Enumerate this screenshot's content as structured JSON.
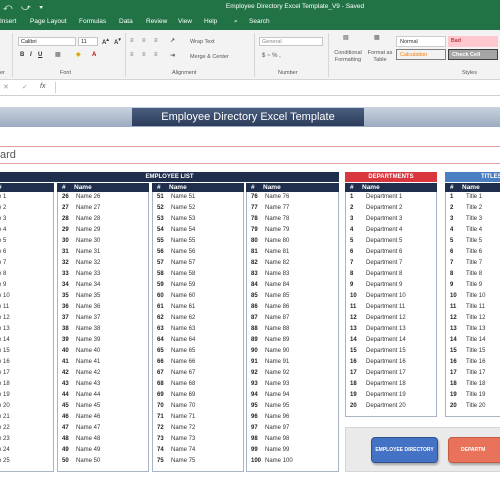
{
  "window": {
    "title": "Employee Directory Excel Template_V9  -  Saved",
    "quick_access": "⤺ ⤻ ▾"
  },
  "ribbon": {
    "tabs": [
      "Insert",
      "Page Layout",
      "Formulas",
      "Data",
      "Review",
      "View",
      "Help"
    ],
    "tell_me": "Search",
    "font_name": "Calibri",
    "font_size": "11",
    "number_format": "General",
    "wrap_text": "Wrap Text",
    "merge_center": "Merge & Center",
    "conditional_formatting": "Conditional Formatting",
    "format_as_table": "Format as Table",
    "styles": {
      "normal": "Normal",
      "bad": "Bad",
      "calculation": "Calculation",
      "check_cell": "Check Cell"
    },
    "groups": {
      "clipboard_tail": "er",
      "font": "Font",
      "alignment": "Alignment",
      "number": "Number",
      "styles": "Styles"
    },
    "currency_sign": "$ ~ % ,"
  },
  "sheet": {
    "banner_title": "Employee Directory Excel Template",
    "dashboard_label": "ard",
    "employee_list_header": "EMPLOYEE LIST",
    "departments_header": "DEPARTMENTS",
    "titles_header": "TITLES",
    "col_num": "#",
    "col_name": "Name",
    "employees_col0": [
      {
        "n": "",
        "name": "e 1"
      },
      {
        "n": "",
        "name": "e 2"
      },
      {
        "n": "",
        "name": "e 3"
      },
      {
        "n": "",
        "name": "e 4"
      },
      {
        "n": "",
        "name": "e 5"
      },
      {
        "n": "",
        "name": "e 6"
      },
      {
        "n": "",
        "name": "e 7"
      },
      {
        "n": "",
        "name": "e 8"
      },
      {
        "n": "",
        "name": "e 9"
      },
      {
        "n": "",
        "name": "e 10"
      },
      {
        "n": "",
        "name": "e 11"
      },
      {
        "n": "",
        "name": "e 12"
      },
      {
        "n": "",
        "name": "e 13"
      },
      {
        "n": "",
        "name": "e 14"
      },
      {
        "n": "",
        "name": "e 15"
      },
      {
        "n": "",
        "name": "e 16"
      },
      {
        "n": "",
        "name": "e 17"
      },
      {
        "n": "",
        "name": "e 18"
      },
      {
        "n": "",
        "name": "e 19"
      },
      {
        "n": "",
        "name": "e 20"
      },
      {
        "n": "",
        "name": "e 21"
      },
      {
        "n": "",
        "name": "e 22"
      },
      {
        "n": "",
        "name": "e 23"
      },
      {
        "n": "",
        "name": "e 24"
      },
      {
        "n": "",
        "name": "e 25"
      }
    ],
    "employees_col1": [
      {
        "n": "26",
        "name": "Name 26"
      },
      {
        "n": "27",
        "name": "Name 27"
      },
      {
        "n": "28",
        "name": "Name 28"
      },
      {
        "n": "29",
        "name": "Name 29"
      },
      {
        "n": "30",
        "name": "Name 30"
      },
      {
        "n": "31",
        "name": "Name 31"
      },
      {
        "n": "32",
        "name": "Name 32"
      },
      {
        "n": "33",
        "name": "Name 33"
      },
      {
        "n": "34",
        "name": "Name 34"
      },
      {
        "n": "35",
        "name": "Name 35"
      },
      {
        "n": "36",
        "name": "Name 36"
      },
      {
        "n": "37",
        "name": "Name 37"
      },
      {
        "n": "38",
        "name": "Name 38"
      },
      {
        "n": "39",
        "name": "Name 39"
      },
      {
        "n": "40",
        "name": "Name 40"
      },
      {
        "n": "41",
        "name": "Name 41"
      },
      {
        "n": "42",
        "name": "Name 42"
      },
      {
        "n": "43",
        "name": "Name 43"
      },
      {
        "n": "44",
        "name": "Name 44"
      },
      {
        "n": "45",
        "name": "Name 45"
      },
      {
        "n": "46",
        "name": "Name 46"
      },
      {
        "n": "47",
        "name": "Name 47"
      },
      {
        "n": "48",
        "name": "Name 48"
      },
      {
        "n": "49",
        "name": "Name 49"
      },
      {
        "n": "50",
        "name": "Name 50"
      }
    ],
    "employees_col2": [
      {
        "n": "51",
        "name": "Name 51"
      },
      {
        "n": "52",
        "name": "Name 52"
      },
      {
        "n": "53",
        "name": "Name 53"
      },
      {
        "n": "54",
        "name": "Name 54"
      },
      {
        "n": "55",
        "name": "Name 55"
      },
      {
        "n": "56",
        "name": "Name 56"
      },
      {
        "n": "57",
        "name": "Name 57"
      },
      {
        "n": "58",
        "name": "Name 58"
      },
      {
        "n": "59",
        "name": "Name 59"
      },
      {
        "n": "60",
        "name": "Name 60"
      },
      {
        "n": "61",
        "name": "Name 61"
      },
      {
        "n": "62",
        "name": "Name 62"
      },
      {
        "n": "63",
        "name": "Name 63"
      },
      {
        "n": "64",
        "name": "Name 64"
      },
      {
        "n": "65",
        "name": "Name 65"
      },
      {
        "n": "66",
        "name": "Name 66"
      },
      {
        "n": "67",
        "name": "Name 67"
      },
      {
        "n": "68",
        "name": "Name 68"
      },
      {
        "n": "69",
        "name": "Name 69"
      },
      {
        "n": "70",
        "name": "Name 70"
      },
      {
        "n": "71",
        "name": "Name 71"
      },
      {
        "n": "72",
        "name": "Name 72"
      },
      {
        "n": "73",
        "name": "Name 73"
      },
      {
        "n": "74",
        "name": "Name 74"
      },
      {
        "n": "75",
        "name": "Name 75"
      }
    ],
    "employees_col3": [
      {
        "n": "76",
        "name": "Name 76"
      },
      {
        "n": "77",
        "name": "Name 77"
      },
      {
        "n": "78",
        "name": "Name 78"
      },
      {
        "n": "79",
        "name": "Name 79"
      },
      {
        "n": "80",
        "name": "Name 80"
      },
      {
        "n": "81",
        "name": "Name 81"
      },
      {
        "n": "82",
        "name": "Name 82"
      },
      {
        "n": "83",
        "name": "Name 83"
      },
      {
        "n": "84",
        "name": "Name 84"
      },
      {
        "n": "85",
        "name": "Name 85"
      },
      {
        "n": "86",
        "name": "Name 86"
      },
      {
        "n": "87",
        "name": "Name 87"
      },
      {
        "n": "88",
        "name": "Name 88"
      },
      {
        "n": "89",
        "name": "Name 89"
      },
      {
        "n": "90",
        "name": "Name 90"
      },
      {
        "n": "91",
        "name": "Name 91"
      },
      {
        "n": "92",
        "name": "Name 92"
      },
      {
        "n": "93",
        "name": "Name 93"
      },
      {
        "n": "94",
        "name": "Name 94"
      },
      {
        "n": "95",
        "name": "Name 95"
      },
      {
        "n": "96",
        "name": "Name 96"
      },
      {
        "n": "97",
        "name": "Name 97"
      },
      {
        "n": "98",
        "name": "Name 98"
      },
      {
        "n": "99",
        "name": "Name 99"
      },
      {
        "n": "100",
        "name": "Name 100"
      }
    ],
    "departments": [
      {
        "n": "1",
        "name": "Department 1"
      },
      {
        "n": "2",
        "name": "Department 2"
      },
      {
        "n": "3",
        "name": "Department 3"
      },
      {
        "n": "4",
        "name": "Department 4"
      },
      {
        "n": "5",
        "name": "Department 5"
      },
      {
        "n": "6",
        "name": "Department 6"
      },
      {
        "n": "7",
        "name": "Department 7"
      },
      {
        "n": "8",
        "name": "Department 8"
      },
      {
        "n": "9",
        "name": "Department 9"
      },
      {
        "n": "10",
        "name": "Department 10"
      },
      {
        "n": "11",
        "name": "Department 11"
      },
      {
        "n": "12",
        "name": "Department 12"
      },
      {
        "n": "13",
        "name": "Department 13"
      },
      {
        "n": "14",
        "name": "Department 14"
      },
      {
        "n": "15",
        "name": "Department 15"
      },
      {
        "n": "16",
        "name": "Department 16"
      },
      {
        "n": "17",
        "name": "Department 17"
      },
      {
        "n": "18",
        "name": "Department 18"
      },
      {
        "n": "19",
        "name": "Department 19"
      },
      {
        "n": "20",
        "name": "Department 20"
      }
    ],
    "titles": [
      {
        "n": "1",
        "name": "Title 1"
      },
      {
        "n": "2",
        "name": "Title 2"
      },
      {
        "n": "3",
        "name": "Title 3"
      },
      {
        "n": "4",
        "name": "Title 4"
      },
      {
        "n": "5",
        "name": "Title 5"
      },
      {
        "n": "6",
        "name": "Title 6"
      },
      {
        "n": "7",
        "name": "Title 7"
      },
      {
        "n": "8",
        "name": "Title 8"
      },
      {
        "n": "9",
        "name": "Title 9"
      },
      {
        "n": "10",
        "name": "Title 10"
      },
      {
        "n": "11",
        "name": "Title 11"
      },
      {
        "n": "12",
        "name": "Title 12"
      },
      {
        "n": "13",
        "name": "Title 13"
      },
      {
        "n": "14",
        "name": "Title 14"
      },
      {
        "n": "15",
        "name": "Title 15"
      },
      {
        "n": "16",
        "name": "Title 16"
      },
      {
        "n": "17",
        "name": "Title 17"
      },
      {
        "n": "18",
        "name": "Title 18"
      },
      {
        "n": "19",
        "name": "Title 19"
      },
      {
        "n": "20",
        "name": "Title 20"
      }
    ],
    "buttons": {
      "employee_directory": "EMPLOYEE DIRECTORY",
      "departments": "DEPARTM"
    },
    "colors": {
      "excel_green": "#217346",
      "header_navy": "#1f2e4c",
      "departments_red": "#d9363e",
      "titles_blue": "#4a7fc1",
      "button_blue": "#4472c4",
      "button_salmon": "#e8735a"
    }
  }
}
